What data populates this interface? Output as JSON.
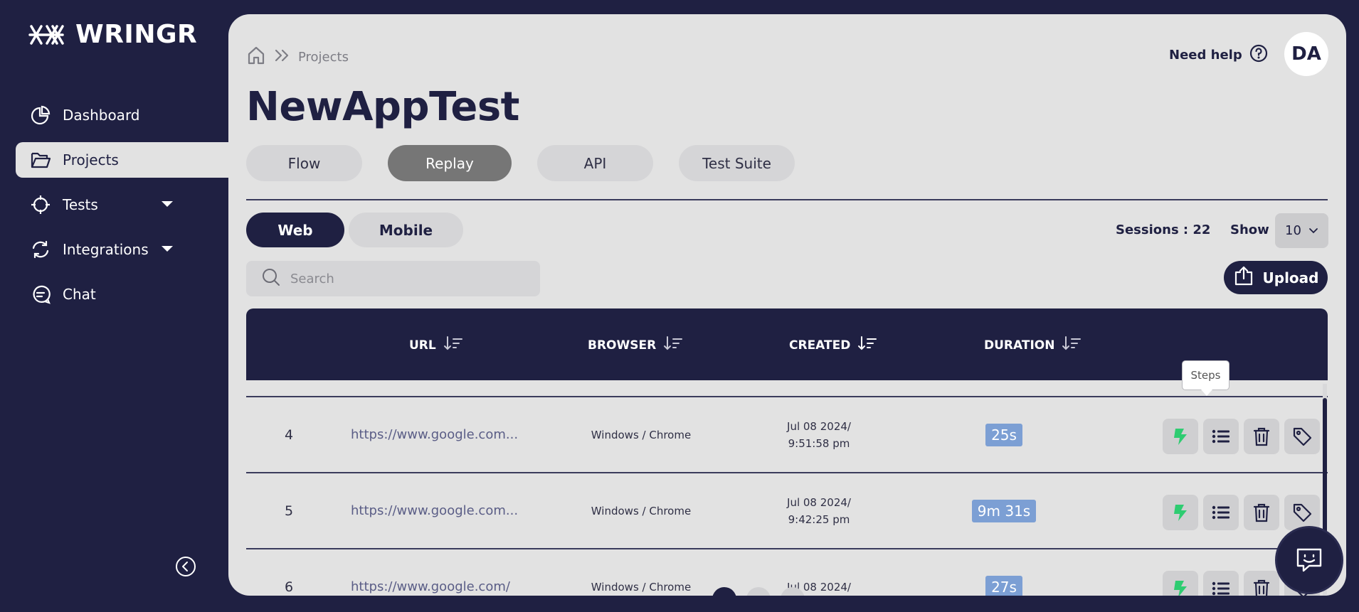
{
  "app": {
    "brand": "WRINGR"
  },
  "sidebar": {
    "items": [
      {
        "label": "Dashboard",
        "icon": "pie-chart-icon"
      },
      {
        "label": "Projects",
        "icon": "folder-icon",
        "active": true
      },
      {
        "label": "Tests",
        "icon": "crosshair-icon",
        "has_dropdown": true
      },
      {
        "label": "Integrations",
        "icon": "sync-icon",
        "has_dropdown": true
      },
      {
        "label": "Chat",
        "icon": "chat-bubble-icon"
      }
    ]
  },
  "header": {
    "breadcrumb": {
      "current": "Projects"
    },
    "title": "NewAppTest",
    "help_label": "Need help",
    "avatar_initials": "DA"
  },
  "tabs": [
    "Flow",
    "Replay",
    "API",
    "Test Suite"
  ],
  "active_tab": "Replay",
  "platform": {
    "web": "Web",
    "mobile": "Mobile",
    "selected": "Web"
  },
  "sessions_label": "Sessions : 22",
  "show": {
    "label": "Show",
    "value": "10"
  },
  "search": {
    "placeholder": "Search",
    "value": ""
  },
  "upload_label": "Upload",
  "table": {
    "columns": [
      "URL",
      "BROWSER",
      "CREATED",
      "DURATION"
    ],
    "rows": [
      {
        "num": "4",
        "url": "https://www.google.com...",
        "browser": "Windows / Chrome",
        "created_date": "Jul 08 2024/",
        "created_time": "9:51:58 pm",
        "duration": "25s"
      },
      {
        "num": "5",
        "url": "https://www.google.com...",
        "browser": "Windows / Chrome",
        "created_date": "Jul 08 2024/",
        "created_time": "9:42:25 pm",
        "duration": "9m 31s"
      },
      {
        "num": "6",
        "url": "https://www.google.com/",
        "browser": "Windows / Chrome",
        "created_date": "Jul 08 2024/",
        "created_time": "",
        "duration": "27s"
      }
    ]
  },
  "tooltip": "Steps",
  "colors": {
    "navy": "#1f2042",
    "panel": "#e2e2e2",
    "accent_green": "#2ecc71",
    "duration_badge": "#7c9fd4"
  }
}
